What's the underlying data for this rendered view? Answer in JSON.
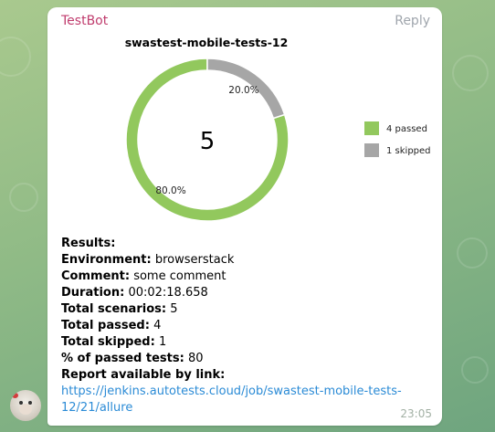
{
  "message": {
    "sender": "TestBot",
    "reply_label": "Reply",
    "time": "23:05",
    "sender_color": "#c03d6e"
  },
  "chart_data": {
    "type": "pie",
    "title": "swastest-mobile-tests-12",
    "center_label": "5",
    "legend_placement": "right",
    "slices": [
      {
        "name": "4 passed",
        "value": 4,
        "percent_label": "80.0%",
        "color": "#92c85d"
      },
      {
        "name": "1 skipped",
        "value": 1,
        "percent_label": "20.0%",
        "color": "#a6a6a6"
      }
    ]
  },
  "results": {
    "heading": "Results:",
    "environment_label": "Environment:",
    "environment_value": "browserstack",
    "comment_label": "Comment:",
    "comment_value": "some comment",
    "duration_label": "Duration:",
    "duration_value": "00:02:18.658",
    "total_scenarios_label": "Total scenarios:",
    "total_scenarios_value": "5",
    "total_passed_label": "Total passed:",
    "total_passed_value": "4",
    "total_skipped_label": "Total skipped:",
    "total_skipped_value": "1",
    "percent_passed_label": "% of passed tests:",
    "percent_passed_value": "80",
    "report_label": "Report available by link:",
    "report_link": "https://jenkins.autotests.cloud/job/swastest-mobile-tests-12/21/allure"
  }
}
